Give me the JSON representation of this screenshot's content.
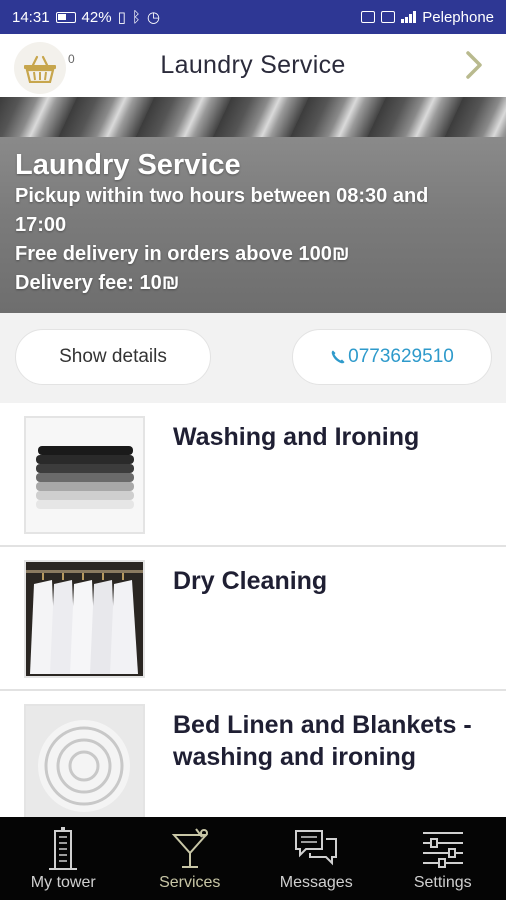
{
  "status_bar": {
    "time": "14:31",
    "battery": "42%",
    "carrier": "Pelephone"
  },
  "header": {
    "title": "Laundry Service",
    "cart_count": "0"
  },
  "hero": {
    "title": "Laundry Service",
    "lines": [
      "Pickup within two hours between 08:30 and 17:00",
      "Free delivery in orders above 100₪",
      "Delivery fee: 10₪"
    ]
  },
  "actions": {
    "details_label": "Show details",
    "phone": "0773629510"
  },
  "services": [
    {
      "label": "Washing and Ironing",
      "icon": "folded-clothes-image"
    },
    {
      "label": "Dry Cleaning",
      "icon": "hanging-shirts-image"
    },
    {
      "label": "Bed Linen and Blankets - washing and ironing",
      "icon": "rolled-linen-image"
    }
  ],
  "nav": [
    {
      "label": "My tower",
      "icon": "tower-icon"
    },
    {
      "label": "Services",
      "icon": "cocktail-icon"
    },
    {
      "label": "Messages",
      "icon": "chat-icon"
    },
    {
      "label": "Settings",
      "icon": "sliders-icon"
    }
  ],
  "colors": {
    "status_bar": "#2e3794",
    "phone_accent": "#2e9acb",
    "nav_background": "#050505"
  }
}
